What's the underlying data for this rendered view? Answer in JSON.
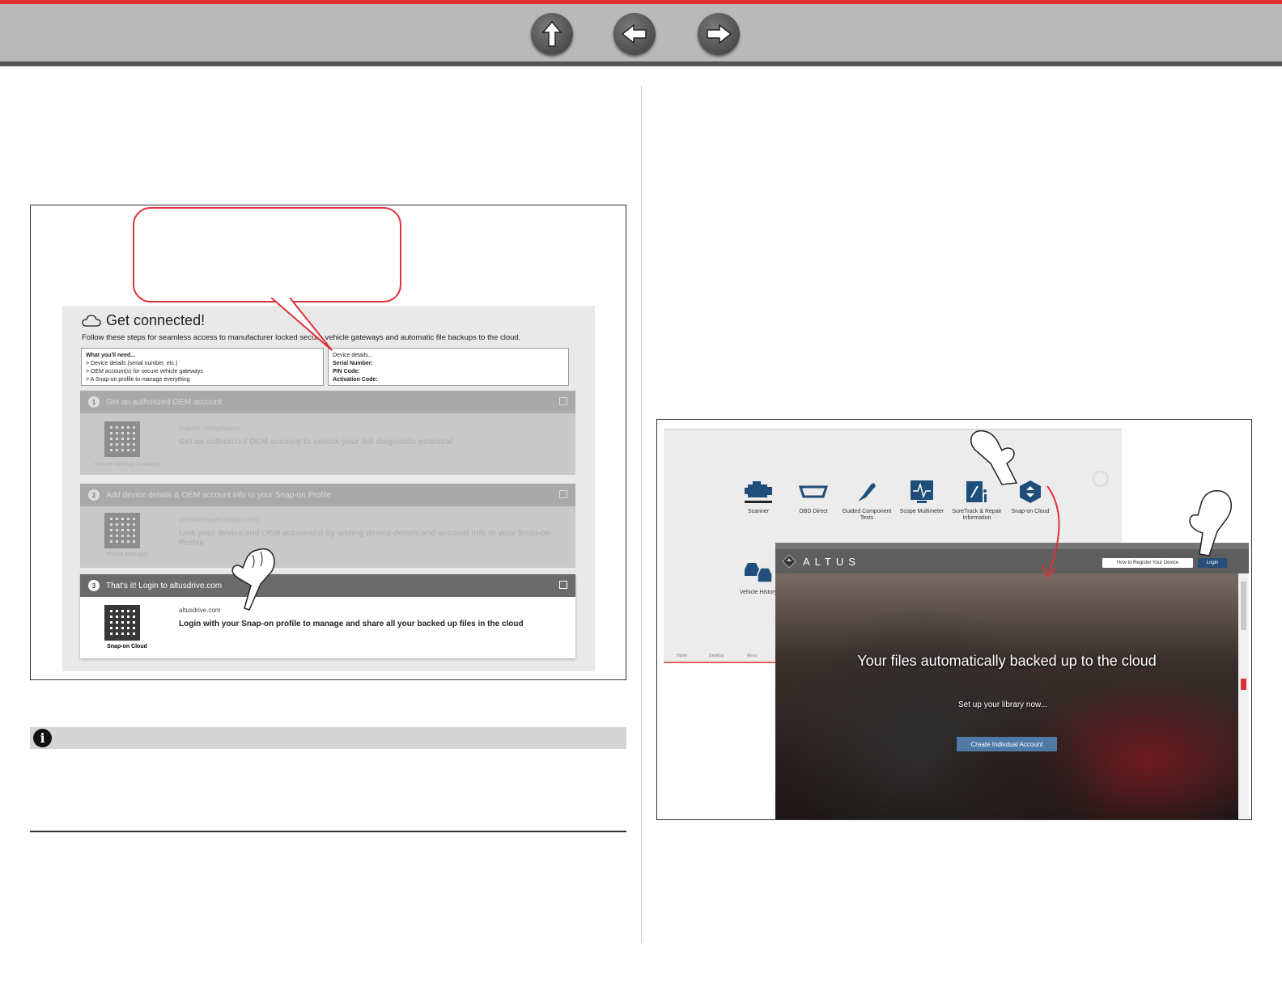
{
  "nav": {
    "up_icon": "up-arrow-icon",
    "back_icon": "left-arrow-icon",
    "forward_icon": "right-arrow-icon"
  },
  "portal": {
    "title": "Get connected!",
    "subtitle": "Follow these steps for seamless access to manufacturer locked secure vehicle gateways and automatic file backups to the cloud.",
    "need": {
      "heading": "What you'll need...",
      "items": [
        "> Device details (serial number, etc.)",
        "> OEM account(s) for secure vehicle gateways",
        "> A Snap-on profile to manage everything"
      ]
    },
    "device": {
      "heading": "Device details...",
      "serial_label": "Serial Number:",
      "pin_label": "PIN Code:",
      "activation_label": "Activation Code:"
    },
    "steps": [
      {
        "num": "1",
        "title": "Get an authorized OEM account",
        "url": "snapon.com/gateway",
        "desc": "Get an authorized OEM account to unlock your full diagnostic potential",
        "qr_label": "Secure Vehicle Gateway"
      },
      {
        "num": "2",
        "title": "Add device details & OEM account info to your Snap-on Profile",
        "url": "profilemanager.snapon.com",
        "desc": "Link your device and OEM account(s) by adding device details and account info to your Snap-on Profile",
        "qr_label": "Profile Manager"
      },
      {
        "num": "3",
        "title": "That's it! Login to altusdrive.com",
        "url": "altusdrive.com",
        "desc": "Login with your Snap-on profile to manage and share all your backed up files in the cloud",
        "qr_label": "Snap-on Cloud"
      }
    ]
  },
  "dashboard": {
    "tiles": [
      {
        "label": "Scanner"
      },
      {
        "label": "OBD Direct"
      },
      {
        "label": "Guided Component Tests"
      },
      {
        "label": "Scope Multimeter"
      },
      {
        "label": "SureTrack & Repair Information"
      },
      {
        "label": "Snap-on Cloud"
      },
      {
        "label": "Vehicle History"
      }
    ],
    "footer": [
      "Home",
      "Desktop",
      "Menu"
    ]
  },
  "altus": {
    "logo": "ALTUS",
    "register_btn": "How to Register Your Device",
    "login_btn": "Login",
    "headline": "Your files automatically backed up to the cloud",
    "setup": "Set up your library now...",
    "create_btn": "Create Indivdual Account"
  },
  "colors": {
    "accent_red": "#e03036",
    "altus_blue": "#4f7aa6",
    "icon_blue": "#1e4e79"
  }
}
